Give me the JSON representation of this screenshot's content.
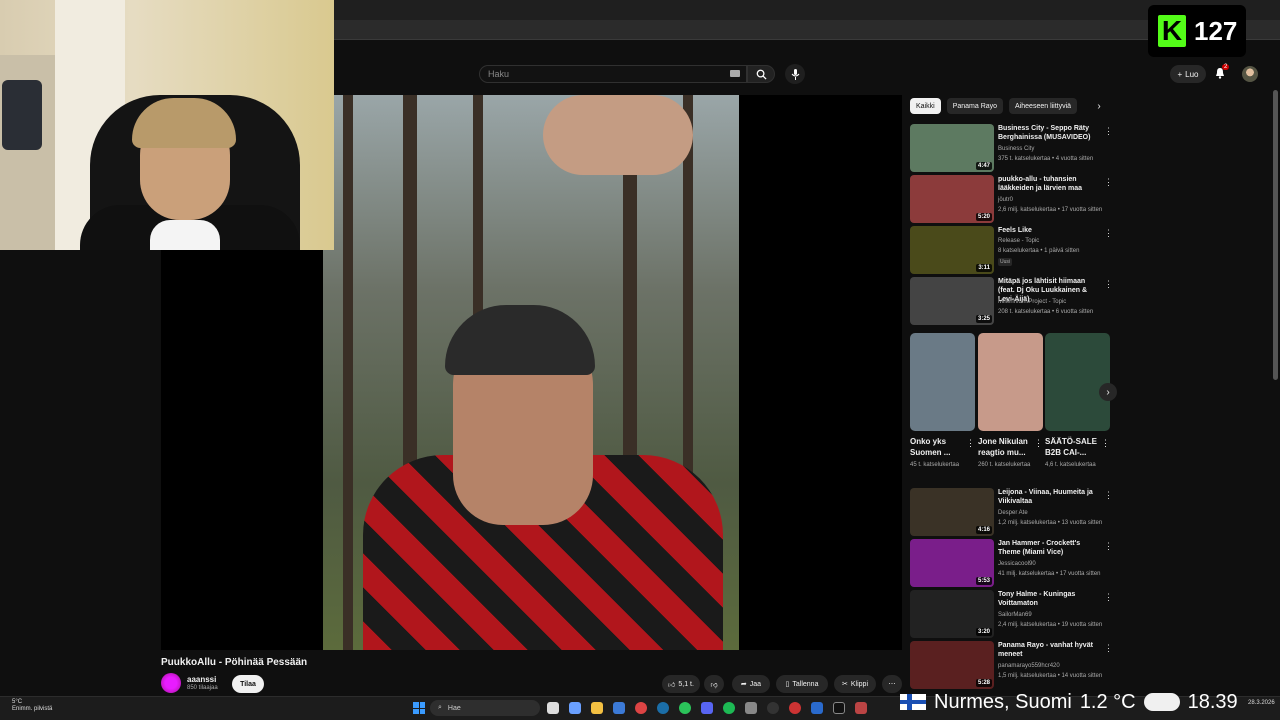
{
  "kick": {
    "count": "127"
  },
  "header": {
    "search_placeholder": "Haku",
    "create_label": "Luo",
    "notif_count": "2"
  },
  "video": {
    "title": "PuukkoAllu - Pöhinää Pessään"
  },
  "channel": {
    "name": "aaanssi",
    "subs": "850 tilaajaa",
    "subscribe_label": "Tilaa"
  },
  "actions": {
    "likes": "5,1 t.",
    "share": "Jaa",
    "save": "Tallenna",
    "clip": "Klippi"
  },
  "chips": [
    "Kaikki",
    "Panama Rayo",
    "Aiheeseen liittyviä"
  ],
  "recs_top": [
    {
      "title": "Business City - Seppo Räty Berghainissa (MUSAVIDEO)",
      "channel": "Business City",
      "meta": "375 t. katselukertaa • 4 vuotta sitten",
      "duration": "4:47",
      "color": "#5d7a61"
    },
    {
      "title": "puukko-allu - tuhansien lääkkeiden ja lärvien maa",
      "channel": "jöutr0",
      "meta": "2,6 milj. katselukertaa • 17 vuotta sitten",
      "duration": "5:20",
      "color": "#8c3b3b"
    },
    {
      "title": "Feels Like",
      "channel": "Release - Topic",
      "meta": "8 katselukertaa • 1 päivä sitten",
      "duration": "3:11",
      "badge": "Uusi",
      "color": "#4a4a1a"
    },
    {
      "title": "Mitäpä jos lähtisit hiimaan (feat. Dj Oku Luukkainen & Levi-Äijä)",
      "channel": "Millennium Project - Topic",
      "meta": "208 t. katselukertaa • 6 vuotta sitten",
      "duration": "3:25",
      "color": "#444"
    }
  ],
  "shorts": [
    {
      "title": "Onko yks Suomen ...",
      "meta": "45 t. katselukertaa",
      "color": "#6a7a86"
    },
    {
      "title": "Jone Nikulan reagtio mu...",
      "meta": "260 t. katselukertaa",
      "color": "#c79a8a"
    },
    {
      "title": "SÄÄTÖ-SALE B2B CAI-...",
      "meta": "4,6 t. katselukertaa",
      "color": "#2c4a3a"
    }
  ],
  "recs_bottom": [
    {
      "title": "Leijona - Viinaa, Huumeita ja Viikivaltaa",
      "channel": "Desper Ate",
      "meta": "1,2 milj. katselukertaa • 13 vuotta sitten",
      "duration": "4:16",
      "color": "#3a3226"
    },
    {
      "title": "Jan Hammer - Crockett's Theme (Miami Vice)",
      "channel": "Jessicacool90",
      "meta": "41 milj. katselukertaa • 17 vuotta sitten",
      "duration": "5:53",
      "color": "#7a1e8a"
    },
    {
      "title": "Tony Halme - Kuningas Voittamaton",
      "channel": "SailorMan69",
      "meta": "2,4 milj. katselukertaa • 19 vuotta sitten",
      "duration": "3:20",
      "color": "#222"
    },
    {
      "title": "Panama Rayo - vanhat hyvät meneet",
      "channel": "panamarayo559hcr420",
      "meta": "1,5 milj. katselukertaa • 14 vuotta sitten",
      "duration": "5:28",
      "color": "#5a2020"
    }
  ],
  "taskbar": {
    "weather_temp": "5°C",
    "weather_desc": "Enimm. pilvistä",
    "search_label": "Hae",
    "date": "28.3.2026"
  },
  "overlay": {
    "location": "Nurmes, Suomi",
    "temp": "1.2 °C",
    "time": "18.39"
  }
}
